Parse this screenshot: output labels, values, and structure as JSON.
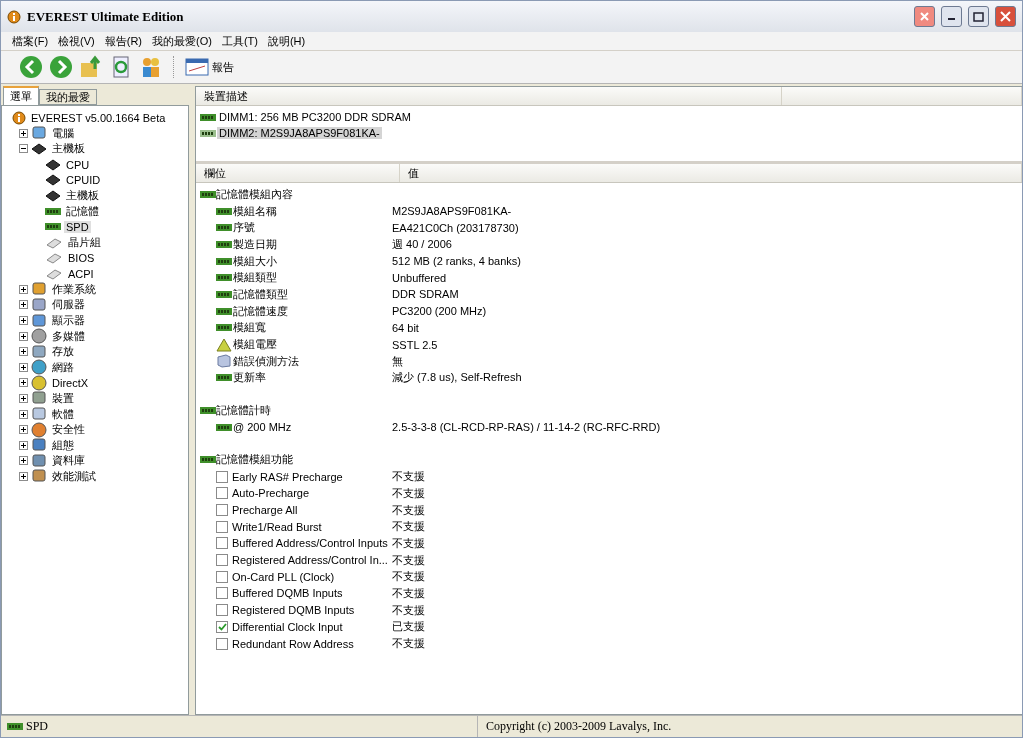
{
  "window": {
    "title": "EVEREST Ultimate Edition"
  },
  "menu": [
    "檔案(F)",
    "檢視(V)",
    "報告(R)",
    "我的最愛(O)",
    "工具(T)",
    "說明(H)"
  ],
  "toolbar": {
    "report_button": "報告"
  },
  "sidebar": {
    "tabs": [
      {
        "label": "選單",
        "selected": true
      },
      {
        "label": "我的最愛",
        "selected": false
      }
    ],
    "tree": {
      "label": "EVEREST v5.00.1664 Beta",
      "children": [
        {
          "label": "電腦",
          "expanded": false
        },
        {
          "label": "主機板",
          "expanded": true,
          "children": [
            {
              "label": "CPU",
              "selected": false
            },
            {
              "label": "CPUID",
              "selected": false
            },
            {
              "label": "主機板",
              "selected": false
            },
            {
              "label": "記憶體",
              "selected": false
            },
            {
              "label": "SPD",
              "selected": true
            },
            {
              "label": "晶片組",
              "selected": false
            },
            {
              "label": "BIOS",
              "selected": false
            },
            {
              "label": "ACPI",
              "selected": false
            }
          ]
        },
        {
          "label": "作業系統",
          "expanded": false
        },
        {
          "label": "伺服器",
          "expanded": false
        },
        {
          "label": "顯示器",
          "expanded": false
        },
        {
          "label": "多媒體",
          "expanded": false
        },
        {
          "label": "存放",
          "expanded": false
        },
        {
          "label": "網路",
          "expanded": false
        },
        {
          "label": "DirectX",
          "expanded": false
        },
        {
          "label": "裝置",
          "expanded": false
        },
        {
          "label": "軟體",
          "expanded": false
        },
        {
          "label": "安全性",
          "expanded": false
        },
        {
          "label": "組態",
          "expanded": false
        },
        {
          "label": "資料庫",
          "expanded": false
        },
        {
          "label": "效能測試",
          "expanded": false
        }
      ]
    }
  },
  "devices": {
    "header": "裝置描述",
    "items": [
      {
        "label": "DIMM1: 256 MB PC3200 DDR SDRAM",
        "selected": false
      },
      {
        "label": "DIMM2: M2S9JA8APS9F081KA-",
        "selected": true
      }
    ]
  },
  "details": {
    "columns": [
      "欄位",
      "值"
    ],
    "sections": [
      {
        "title": "記憶體模組內容",
        "rows": [
          {
            "kind": "memory",
            "field": "模組名稱",
            "value": "M2S9JA8APS9F081KA-"
          },
          {
            "kind": "memory",
            "field": "序號",
            "value": "EA421C0Ch (203178730)"
          },
          {
            "kind": "memory",
            "field": "製造日期",
            "value": "週 40 / 2006"
          },
          {
            "kind": "memory",
            "field": "模組大小",
            "value": "512 MB (2 ranks, 4 banks)"
          },
          {
            "kind": "memory",
            "field": "模組類型",
            "value": "Unbuffered"
          },
          {
            "kind": "memory",
            "field": "記憶體類型",
            "value": "DDR SDRAM"
          },
          {
            "kind": "memory",
            "field": "記憶體速度",
            "value": "PC3200 (200 MHz)"
          },
          {
            "kind": "memory",
            "field": "模組寬",
            "value": "64 bit"
          },
          {
            "kind": "voltage",
            "field": "模組電壓",
            "value": "SSTL 2.5"
          },
          {
            "kind": "ecc",
            "field": "錯誤偵測方法",
            "value": "無"
          },
          {
            "kind": "memory",
            "field": "更新率",
            "value": "減少 (7.8 us), Self-Refresh"
          }
        ]
      },
      {
        "title": "記憶體計時",
        "rows": [
          {
            "kind": "memory",
            "field": "@ 200 MHz",
            "value": "2.5-3-3-8  (CL-RCD-RP-RAS) / 11-14-2  (RC-RFC-RRD)"
          }
        ]
      },
      {
        "title": "記憶體模組功能",
        "rows": [
          {
            "kind": "check",
            "checked": false,
            "field": "Early RAS# Precharge",
            "value": "不支援"
          },
          {
            "kind": "check",
            "checked": false,
            "field": "Auto-Precharge",
            "value": "不支援"
          },
          {
            "kind": "check",
            "checked": false,
            "field": "Precharge All",
            "value": "不支援"
          },
          {
            "kind": "check",
            "checked": false,
            "field": "Write1/Read Burst",
            "value": "不支援"
          },
          {
            "kind": "check",
            "checked": false,
            "field": "Buffered Address/Control Inputs",
            "value": "不支援"
          },
          {
            "kind": "check",
            "checked": false,
            "field": "Registered Address/Control In...",
            "value": "不支援"
          },
          {
            "kind": "check",
            "checked": false,
            "field": "On-Card PLL (Clock)",
            "value": "不支援"
          },
          {
            "kind": "check",
            "checked": false,
            "field": "Buffered DQMB Inputs",
            "value": "不支援"
          },
          {
            "kind": "check",
            "checked": false,
            "field": "Registered DQMB Inputs",
            "value": "不支援"
          },
          {
            "kind": "check",
            "checked": true,
            "field": "Differential Clock Input",
            "value": "已支援"
          },
          {
            "kind": "check",
            "checked": false,
            "field": "Redundant Row Address",
            "value": "不支援"
          }
        ]
      }
    ]
  },
  "status_bar": {
    "left": "SPD",
    "center": "Copyright (c) 2003-2009 Lavalys, Inc."
  }
}
